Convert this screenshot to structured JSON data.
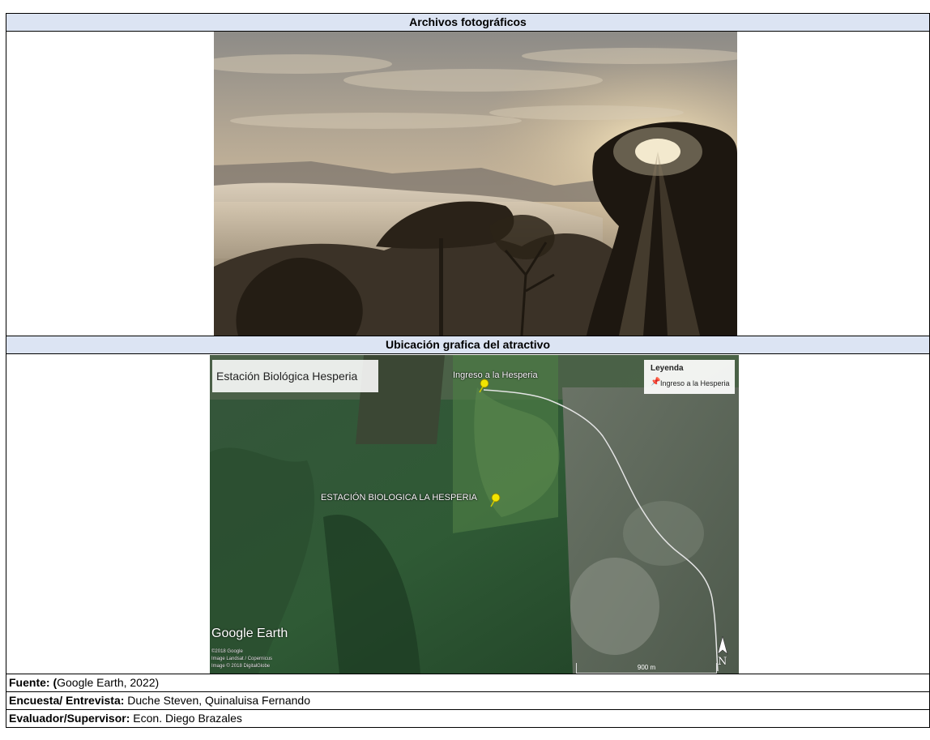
{
  "sections": {
    "photo_header": "Archivos fotográficos",
    "map_header": "Ubicación grafica del atractivo"
  },
  "map": {
    "title": "Estación Biológica Hesperia",
    "legend_title": "Leyenda",
    "legend_item": "Ingreso a la Hesperia",
    "pin_entrance_label": "Ingreso a la Hesperia",
    "pin_station_label": "ESTACIÓN BIOLOGICA LA HESPERIA",
    "logo": "Google Earth",
    "credits": [
      "©2018 Google",
      "Image Landsat / Copernicus",
      "Image © 2018 DigitalGlobe"
    ],
    "scale": "900 m",
    "north": "N"
  },
  "notes": {
    "fuente_label": "Fuente: (",
    "fuente_value": "Google Earth, 2022)",
    "encuesta_label": "Encuesta/ Entrevista:",
    "encuesta_value": " Duche Steven, Quinaluisa Fernando",
    "evaluador_label": "Evaluador/Supervisor:",
    "evaluador_value": " Econ. Diego Brazales"
  },
  "colors": {
    "header_bg": "#dce4f3",
    "pin": "#f2e400"
  }
}
